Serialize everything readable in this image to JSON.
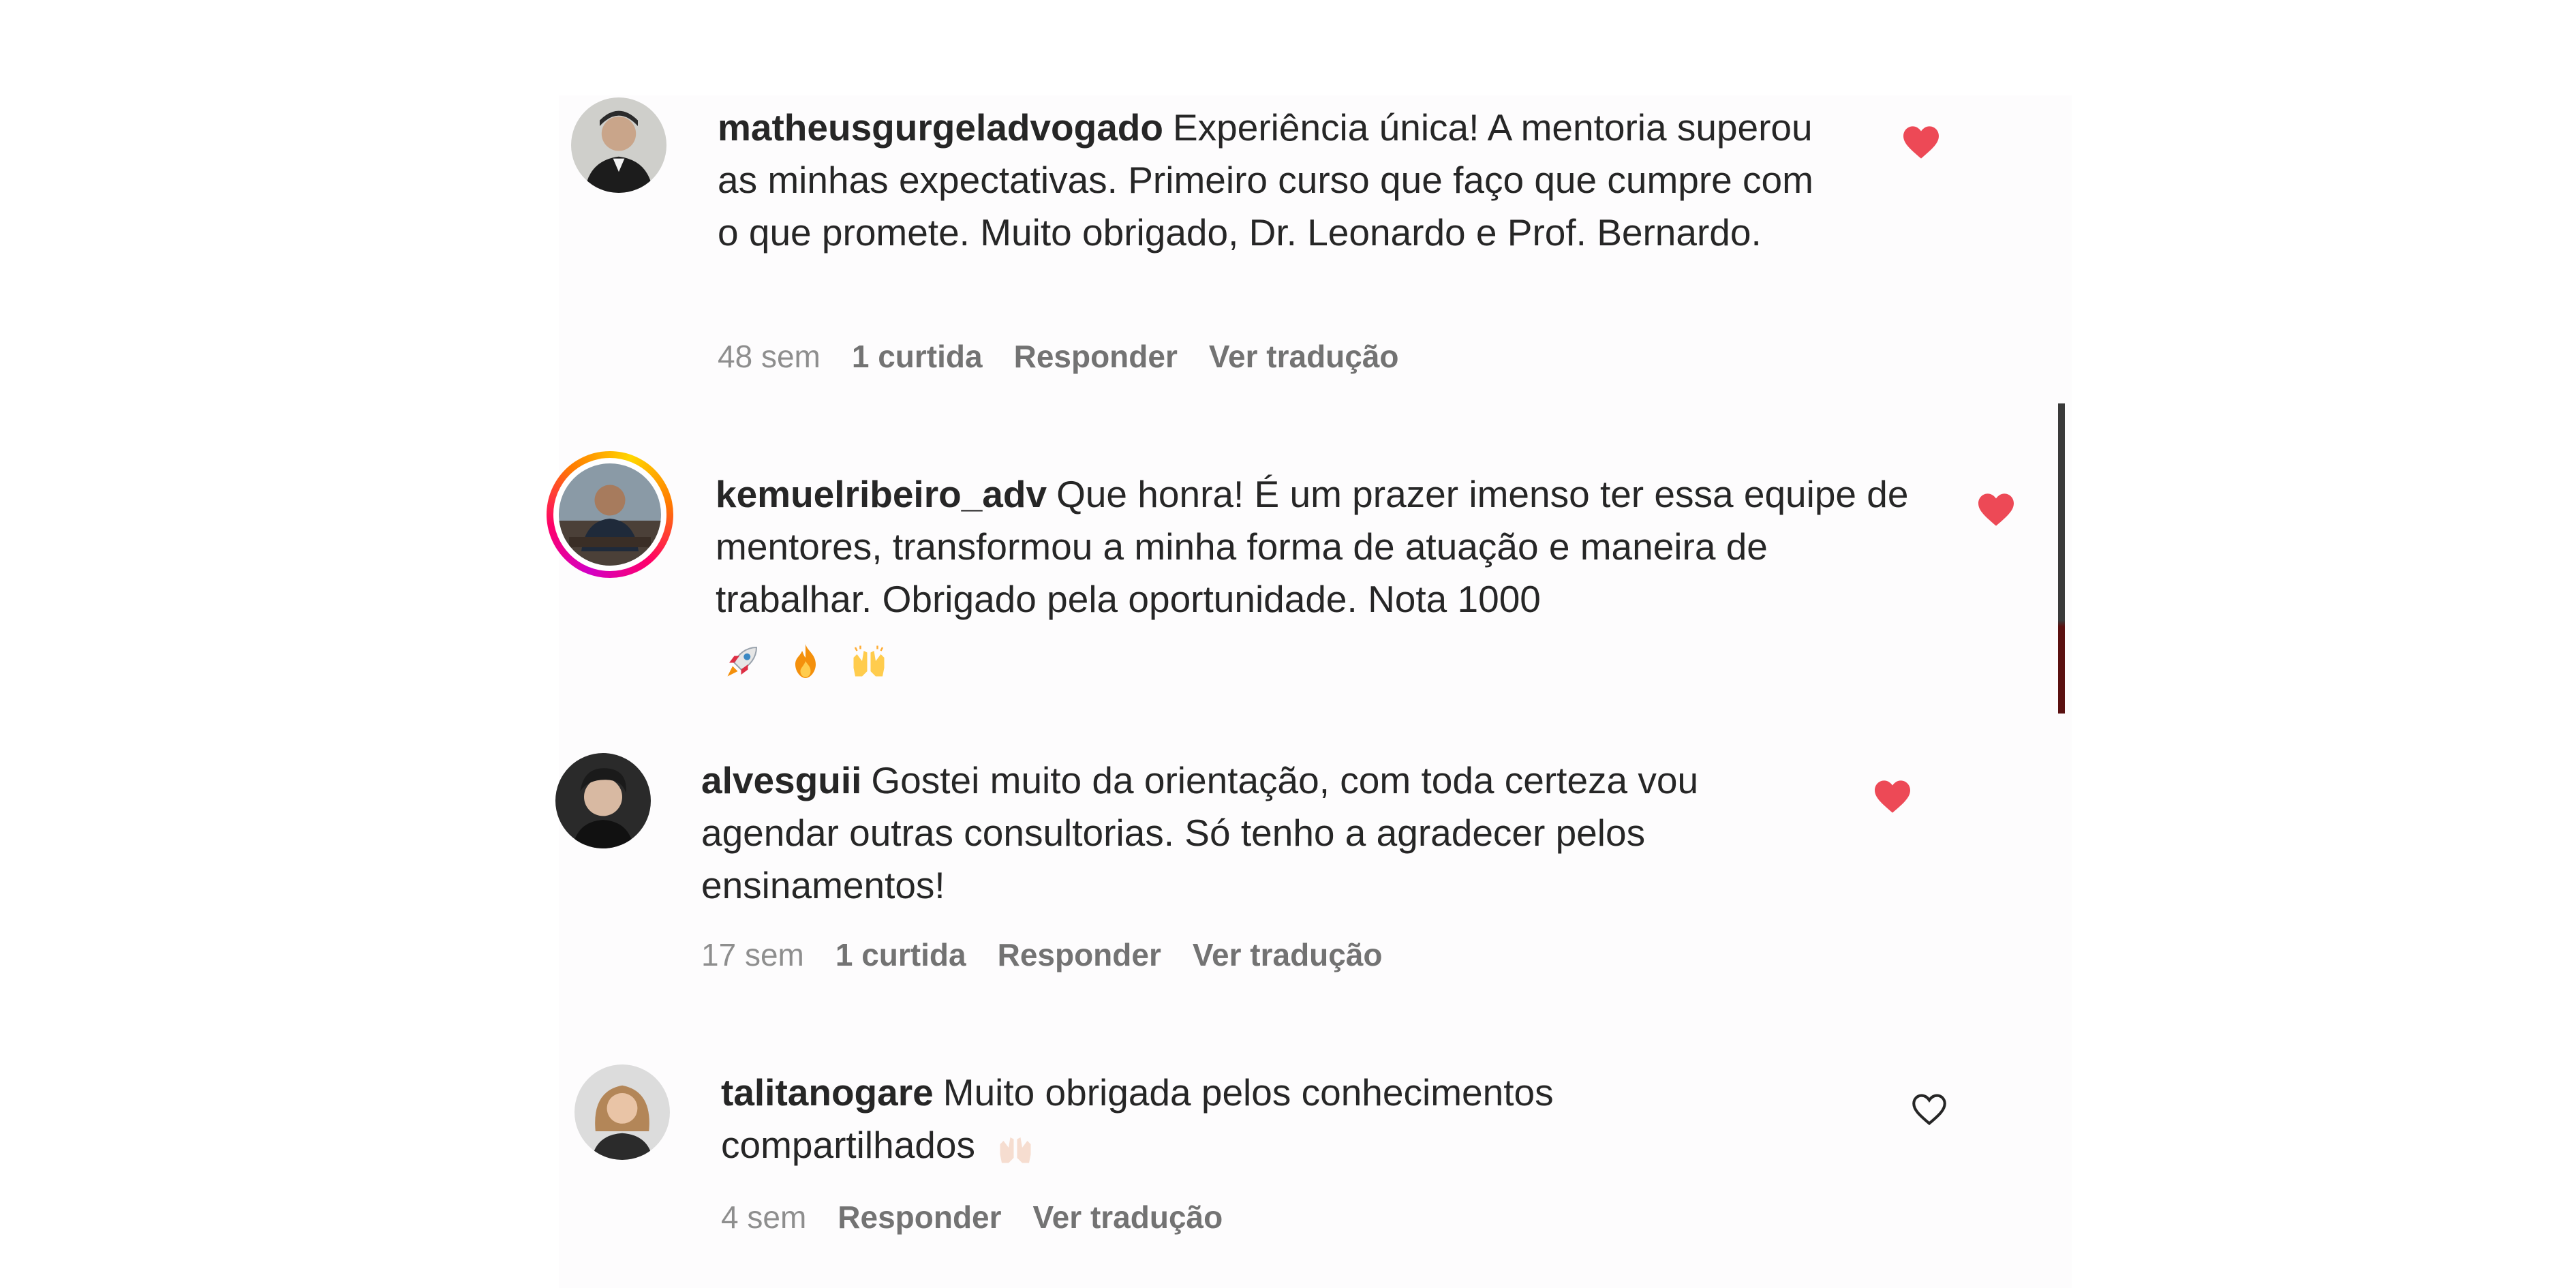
{
  "colors": {
    "heart_liked": "#ed4956",
    "meta_text": "#8e8e8e",
    "story_ring": [
      "#d300c5",
      "#ff0069",
      "#ff7a00",
      "#ffd600"
    ]
  },
  "comments": [
    {
      "username": "matheusgurgeladvogado",
      "text": "Experiência única! A mentoria superou as minhas expectativas. Primeiro curso que faço que cumpre com o que promete. Muito obrigado, Dr. Leonardo e Prof. Bernardo.",
      "time": "48 sem",
      "likes": "1 curtida",
      "reply": "Responder",
      "translate": "Ver tradução",
      "liked": true,
      "heart_icon": "heart-filled-icon"
    },
    {
      "username": "kemuelribeiro_adv",
      "text": "Que honra! É um prazer imenso ter essa equipe de mentores, transformou a minha forma de atuação e maneira de trabalhar. Obrigado pela oportunidade. Nota 1000",
      "emojis": [
        "rocket-emoji",
        "fire-emoji",
        "raising-hands-emoji"
      ],
      "liked": true,
      "has_story_ring": true,
      "heart_icon": "heart-filled-icon"
    },
    {
      "username": "alvesguii",
      "text": "Gostei muito da orientação, com toda certeza vou agendar outras consultorias. Só tenho a agradecer pelos ensinamentos!",
      "time": "17 sem",
      "likes": "1 curtida",
      "reply": "Responder",
      "translate": "Ver tradução",
      "liked": true,
      "heart_icon": "heart-filled-icon"
    },
    {
      "username": "talitanogare",
      "text": "Muito obrigada pelos conhecimentos compartilhados",
      "emojis": [
        "raising-hands-light-emoji"
      ],
      "time": "4 sem",
      "reply": "Responder",
      "translate": "Ver tradução",
      "liked": false,
      "heart_icon": "heart-outline-icon"
    }
  ]
}
